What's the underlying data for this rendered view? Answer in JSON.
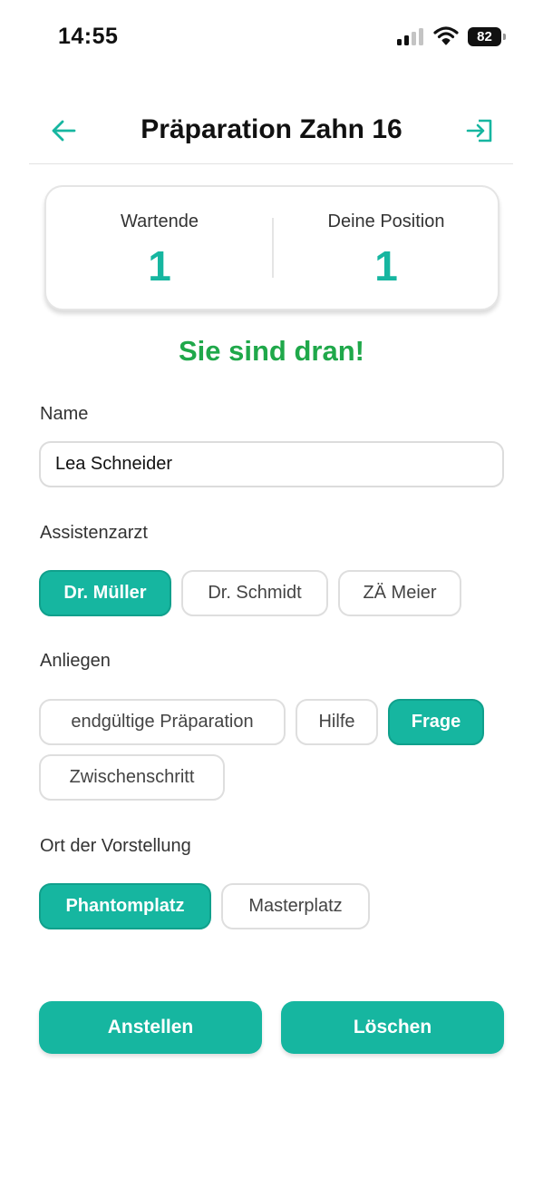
{
  "status_bar": {
    "time": "14:55",
    "battery": "82"
  },
  "header": {
    "title": "Präparation Zahn 16",
    "back_icon": "arrow-left-icon",
    "action_icon": "login-icon"
  },
  "queue": {
    "waiting_label": "Wartende",
    "waiting_value": "1",
    "position_label": "Deine Position",
    "position_value": "1"
  },
  "status_message": "Sie sind dran!",
  "form": {
    "name_label": "Name",
    "name_value": "Lea Schneider",
    "assistant_label": "Assistenzarzt",
    "assistants": [
      {
        "label": "Dr. Müller",
        "selected": true
      },
      {
        "label": "Dr. Schmidt",
        "selected": false
      },
      {
        "label": "ZÄ Meier",
        "selected": false
      }
    ],
    "concern_label": "Anliegen",
    "concerns": [
      {
        "label": "endgültige Präparation",
        "selected": false
      },
      {
        "label": "Hilfe",
        "selected": false
      },
      {
        "label": "Frage",
        "selected": true
      },
      {
        "label": "Zwischenschritt",
        "selected": false
      }
    ],
    "location_label": "Ort der Vorstellung",
    "locations": [
      {
        "label": "Phantomplatz",
        "selected": true
      },
      {
        "label": "Masterplatz",
        "selected": false
      }
    ]
  },
  "actions": {
    "submit_label": "Anstellen",
    "delete_label": "Löschen"
  },
  "colors": {
    "accent": "#16b6a0",
    "success": "#1fa84a",
    "border": "#dedede"
  }
}
